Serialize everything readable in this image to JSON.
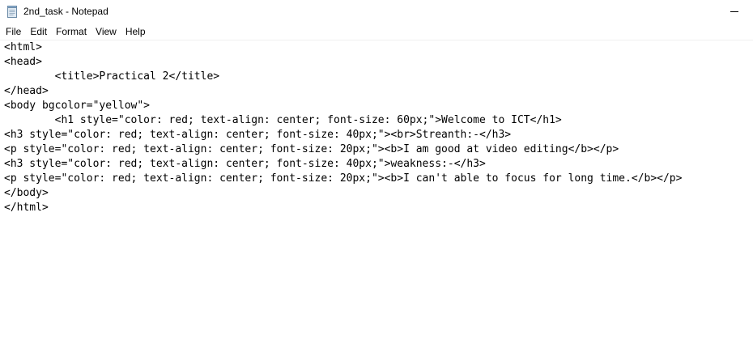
{
  "window": {
    "title": "2nd_task - Notepad"
  },
  "menubar": {
    "items": [
      {
        "label": "File"
      },
      {
        "label": "Edit"
      },
      {
        "label": "Format"
      },
      {
        "label": "View"
      },
      {
        "label": "Help"
      }
    ]
  },
  "editor": {
    "lines": [
      "<html>",
      "<head>",
      "        <title>Practical 2</title>",
      "</head>",
      "<body bgcolor=\"yellow\">",
      "        <h1 style=\"color: red; text-align: center; font-size: 60px;\">Welcome to ICT</h1>",
      "<h3 style=\"color: red; text-align: center; font-size: 40px;\"><br>Streanth:-</h3>",
      "<p style=\"color: red; text-align: center; font-size: 20px;\"><b>I am good at video editing</b></p>",
      "<h3 style=\"color: red; text-align: center; font-size: 40px;\">weakness:-</h3>",
      "<p style=\"color: red; text-align: center; font-size: 20px;\"><b>I can't able to focus for long time.</b></p>",
      "</body>",
      "</html>"
    ]
  },
  "icons": {
    "app": "notepad-icon",
    "minimize": "minimize-icon"
  }
}
